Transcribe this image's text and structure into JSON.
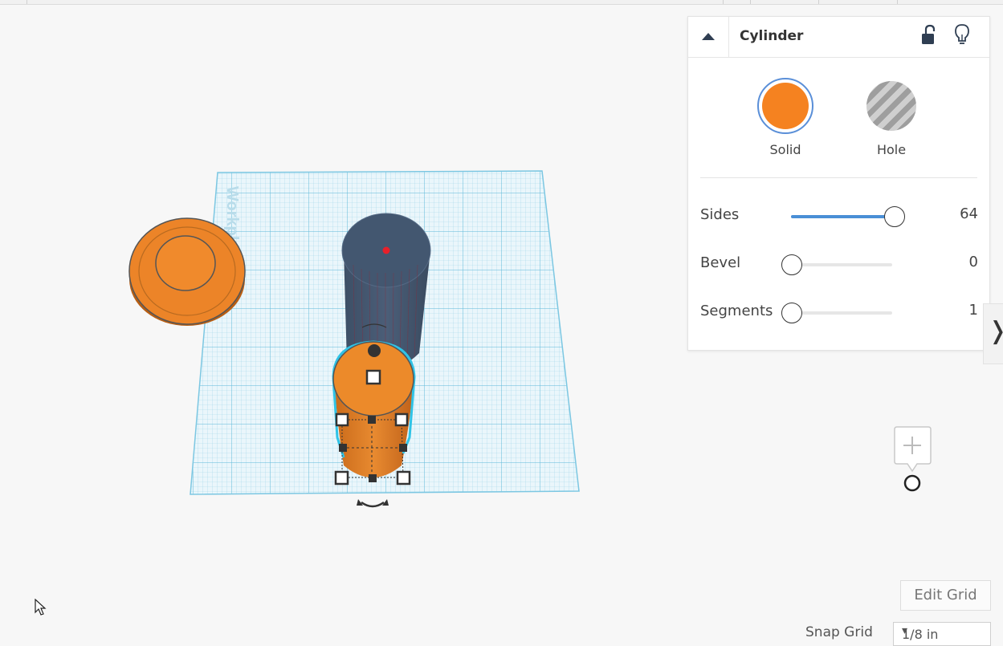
{
  "inspector": {
    "title": "Cylinder",
    "solid_label": "Solid",
    "hole_label": "Hole",
    "solid_color": "#f58220",
    "sides_label": "Sides",
    "sides_value": "64",
    "bevel_label": "Bevel",
    "bevel_value": "0",
    "segments_label": "Segments",
    "segments_value": "1",
    "collapse_icon": "caret-up-icon",
    "lock_icon": "unlock-icon",
    "bulb_icon": "lightbulb-icon"
  },
  "workplane": {
    "label": "Workplane"
  },
  "controls": {
    "edit_grid_label": "Edit Grid",
    "snap_grid_label": "Snap Grid",
    "snap_grid_value": "1/8 in"
  }
}
